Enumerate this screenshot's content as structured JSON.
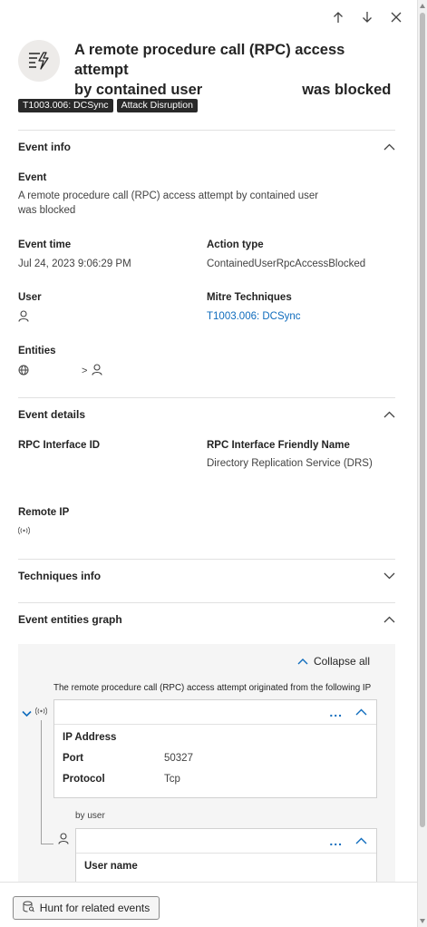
{
  "nav": {
    "up_icon": "arrow-up-icon",
    "down_icon": "arrow-down-icon",
    "close_icon": "close-icon"
  },
  "header": {
    "icon": "lightning-list-icon",
    "title_line1": "A remote procedure call (RPC) access attempt",
    "title_line2_a": "by contained user",
    "title_line2_b": "was blocked"
  },
  "tags": [
    "T1003.006: DCSync",
    "Attack Disruption"
  ],
  "event_info": {
    "title": "Event info",
    "event_label": "Event",
    "event_value": "A remote procedure call (RPC) access attempt by contained user was blocked",
    "event_time_label": "Event time",
    "event_time_value": "Jul 24, 2023 9:06:29 PM",
    "action_type_label": "Action type",
    "action_type_value": "ContainedUserRpcAccessBlocked",
    "user_label": "User",
    "mitre_label": "Mitre Techniques",
    "mitre_value": "T1003.006: DCSync",
    "entities_label": "Entities",
    "entities_separator": ">"
  },
  "event_details": {
    "title": "Event details",
    "rpc_id_label": "RPC Interface ID",
    "rpc_name_label": "RPC Interface Friendly Name",
    "rpc_name_value": "Directory Replication Service (DRS)",
    "remote_ip_label": "Remote IP"
  },
  "techniques_info": {
    "title": "Techniques info"
  },
  "graph": {
    "title": "Event entities graph",
    "collapse_all": "Collapse all",
    "description": "The remote procedure call (RPC) access attempt originated from the following IP",
    "ip_card": {
      "more": "...",
      "heading": "IP Address",
      "port_label": "Port",
      "port_value": "50327",
      "protocol_label": "Protocol",
      "protocol_value": "Tcp"
    },
    "by_user": "by user",
    "user_card": {
      "more": "...",
      "heading": "User name"
    }
  },
  "footer": {
    "hunt_button": "Hunt for related events"
  },
  "colors": {
    "accent": "#0f6cbd",
    "tag_bg": "#292929",
    "graph_bg": "#f5f5f5"
  }
}
